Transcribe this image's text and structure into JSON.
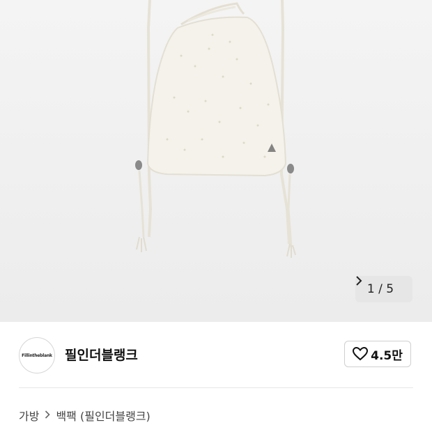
{
  "gallery": {
    "pager_text": "1 / 5",
    "next_icon": "chevron-right-icon"
  },
  "seller": {
    "avatar_text": "Fillintheblank",
    "name": "필인더블랭크"
  },
  "like": {
    "icon": "heart-outline-icon",
    "count": "4.5만"
  },
  "breadcrumb": {
    "items": [
      "가방",
      "백팩 (필인더블랭크)"
    ],
    "separator_icon": "chevron-right-icon"
  }
}
